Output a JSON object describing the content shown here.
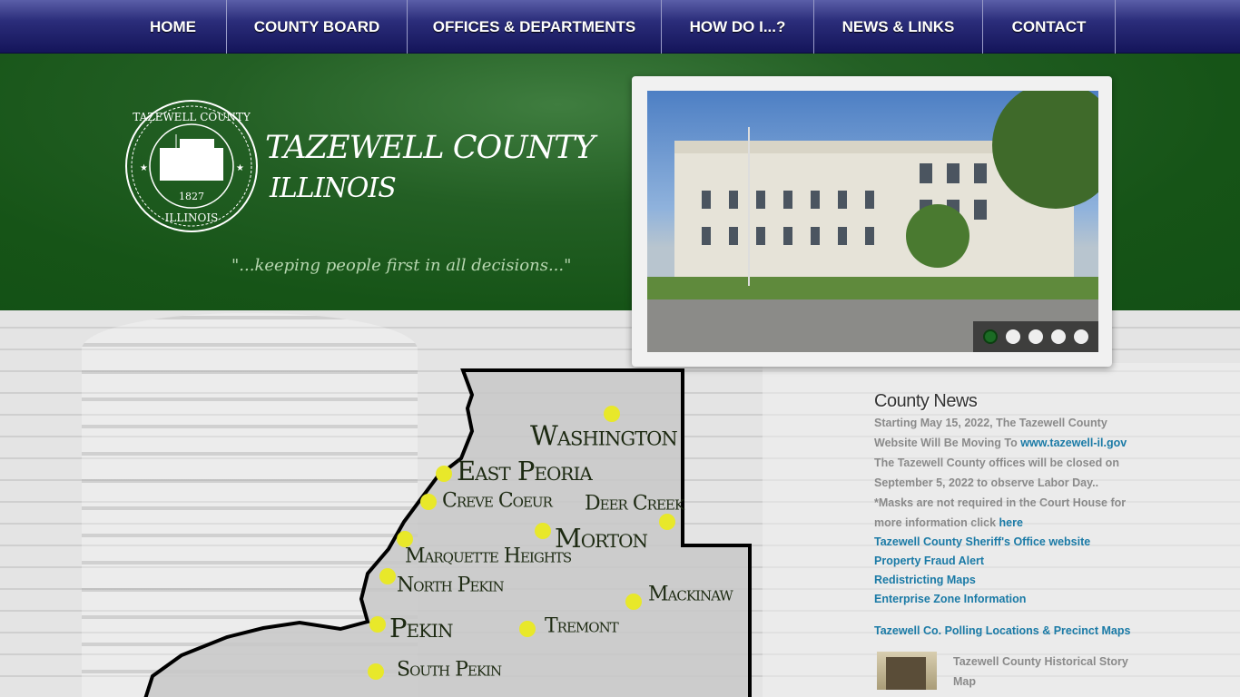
{
  "nav": {
    "items": [
      "HOME",
      "COUNTY BOARD",
      "OFFICES & DEPARTMENTS",
      "HOW DO I...?",
      "NEWS & LINKS",
      "CONTACT"
    ]
  },
  "header": {
    "title": "TAZEWELL COUNTY",
    "subtitle": "ILLINOIS",
    "motto": "\"...keeping people first in all decisions...\"",
    "seal": {
      "top": "TAZEWELL COUNTY",
      "year": "1827",
      "bottom": "ILLINOIS"
    }
  },
  "slider": {
    "slide_count": 5,
    "active_slide": 1
  },
  "map": {
    "towns": [
      "Washington",
      "East Peoria",
      "Creve Coeur",
      "Deer Creek",
      "Morton",
      "Marquette Heights",
      "North Pekin",
      "Mackinaw",
      "Pekin",
      "Tremont",
      "South Pekin"
    ],
    "dot_color": "#e8e82a"
  },
  "news": {
    "title": "County News",
    "item1_text": "Starting May 15, 2022, The Tazewell County Website Will Be Moving To ",
    "item1_link": "www.tazewell-il.gov",
    "item2_text": "The Tazewell County offices will be closed on  September 5, 2022 to observe Labor Day..",
    "item3_text": "*Masks are not required in the Court House for more information click ",
    "item3_link": "here",
    "links": [
      "Tazewell County  Sheriff's Office website",
      "Property Fraud Alert",
      "Redistricting Maps",
      "Enterprise Zone Information"
    ],
    "polling": "Tazewell Co. Polling Locations & Precinct Maps",
    "historical": "Tazewell County Historical Story Map"
  }
}
